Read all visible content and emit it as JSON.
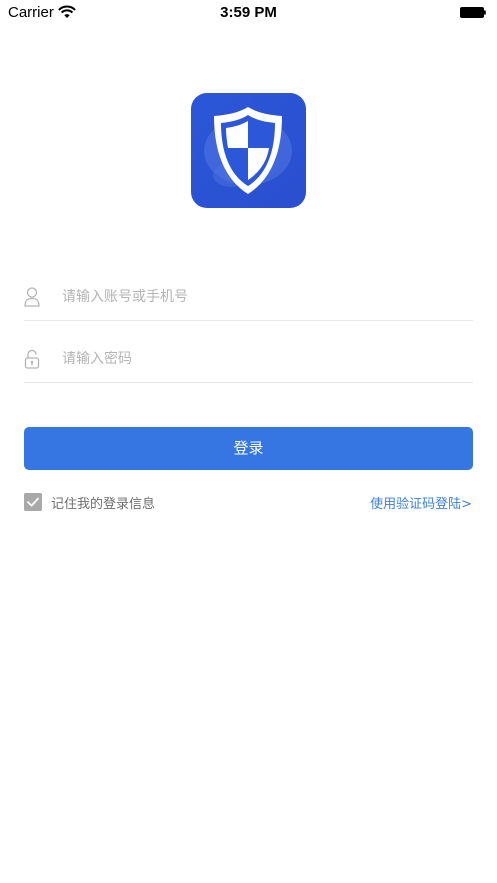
{
  "status_bar": {
    "carrier": "Carrier",
    "time": "3:59 PM",
    "wifi_icon": "wifi-icon",
    "battery_icon": "battery-icon"
  },
  "logo": {
    "icon": "shield-icon",
    "background_color": "#2a56d6"
  },
  "form": {
    "account": {
      "icon": "user-icon",
      "placeholder": "请输入账号或手机号",
      "value": ""
    },
    "password": {
      "icon": "lock-icon",
      "placeholder": "请输入密码",
      "value": ""
    },
    "login_button": "登录",
    "remember_me": {
      "label": "记住我的登录信息",
      "checked": true
    },
    "sms_login_link": "使用验证码登陆>"
  },
  "colors": {
    "primary": "#3676e2",
    "link": "#3d7fe0",
    "checkbox": "#a9a9a9"
  }
}
